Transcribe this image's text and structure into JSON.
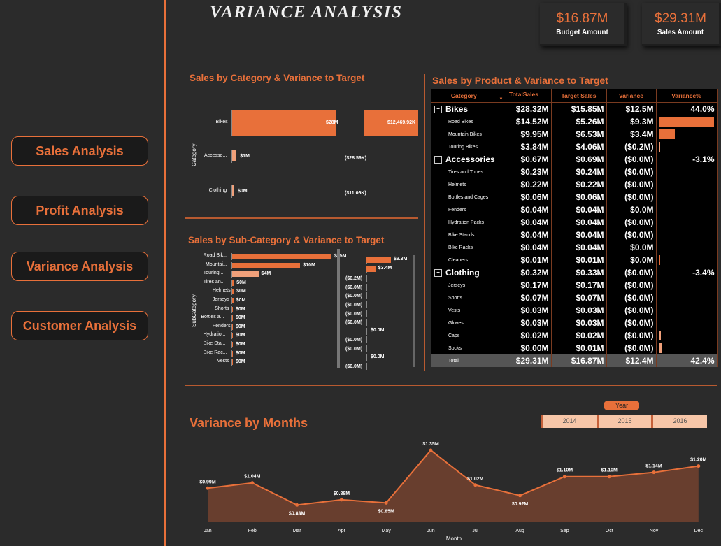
{
  "title": "VARIANCE  ANALYSIS",
  "kpis": [
    {
      "value": "$16.87M",
      "label": "Budget Amount"
    },
    {
      "value": "$29.31M",
      "label": "Sales Amount"
    }
  ],
  "nav": [
    "Sales Analysis",
    "Profit Analysis",
    "Variance Analysis",
    "Customer Analysis"
  ],
  "category_chart": {
    "title": "Sales by Category & Variance to Target",
    "axis_title": "Category",
    "rows": [
      {
        "label": "Bikes",
        "sales": "$28M",
        "sales_value": 28,
        "var": "$12,469.92K",
        "var_value": 12469.92
      },
      {
        "label": "Accesso...",
        "sales": "$1M",
        "sales_value": 1,
        "var": "($28.59K)",
        "var_value": -28.59
      },
      {
        "label": "Clothing",
        "sales": "$0M",
        "sales_value": 0.3,
        "var": "($11.06K)",
        "var_value": -11.06
      }
    ]
  },
  "subcategory_chart": {
    "title": "Sales by Sub-Category & Variance to Target",
    "axis_title": "SubCategory",
    "rows": [
      {
        "label": "Road Bik...",
        "sales": "$15M",
        "sales_value": 14.52,
        "var": "$9.3M",
        "var_value": 9.3
      },
      {
        "label": "Mountai...",
        "sales": "$10M",
        "sales_value": 9.95,
        "var": "$3.4M",
        "var_value": 3.4
      },
      {
        "label": "Touring ...",
        "sales": "$4M",
        "sales_value": 3.84,
        "var": "($0.2M)",
        "var_value": -0.2
      },
      {
        "label": "Tires an...",
        "sales": "$0M",
        "sales_value": 0.23,
        "var": "($0.0M)",
        "var_value": -0.01
      },
      {
        "label": "Helmets",
        "sales": "$0M",
        "sales_value": 0.22,
        "var": "($0.0M)",
        "var_value": -0.01
      },
      {
        "label": "Jerseys",
        "sales": "$0M",
        "sales_value": 0.17,
        "var": "($0.0M)",
        "var_value": -0.01
      },
      {
        "label": "Shorts",
        "sales": "$0M",
        "sales_value": 0.07,
        "var": "($0.0M)",
        "var_value": -0.01
      },
      {
        "label": "Bottles a...",
        "sales": "$0M",
        "sales_value": 0.06,
        "var": "($0.0M)",
        "var_value": -0.01
      },
      {
        "label": "Fenders",
        "sales": "$0M",
        "sales_value": 0.04,
        "var": "$0.0M",
        "var_value": 0.0
      },
      {
        "label": "Hydratio...",
        "sales": "$0M",
        "sales_value": 0.04,
        "var": "($0.0M)",
        "var_value": -0.01
      },
      {
        "label": "Bike Sta...",
        "sales": "$0M",
        "sales_value": 0.04,
        "var": "($0.0M)",
        "var_value": -0.01
      },
      {
        "label": "Bike Rac...",
        "sales": "$0M",
        "sales_value": 0.04,
        "var": "$0.0M",
        "var_value": 0.0
      },
      {
        "label": "Vests",
        "sales": "$0M",
        "sales_value": 0.03,
        "var": "($0.0M)",
        "var_value": -0.01
      }
    ]
  },
  "matrix": {
    "title": "Sales by Product & Variance to Target",
    "headers": [
      "Category",
      "TotalSales",
      "Target Sales",
      "Variance",
      "Variance%"
    ],
    "rows": [
      {
        "type": "group",
        "name": "Bikes",
        "sales": "$28.32M",
        "target": "$15.85M",
        "variance": "$12.5M",
        "pct": "44.0%"
      },
      {
        "type": "item",
        "name": "Road Bikes",
        "sales": "$14.52M",
        "target": "$5.26M",
        "variance": "$9.3M",
        "pct_value": 176
      },
      {
        "type": "item",
        "name": "Mountain Bikes",
        "sales": "$9.95M",
        "target": "$6.53M",
        "variance": "$3.4M",
        "pct_value": 52
      },
      {
        "type": "item",
        "name": "Touring Bikes",
        "sales": "$3.84M",
        "target": "$4.06M",
        "variance": "($0.2M)",
        "pct_value": -5
      },
      {
        "type": "group",
        "name": "Accessories",
        "sales": "$0.67M",
        "target": "$0.69M",
        "variance": "($0.0M)",
        "pct": "-3.1%"
      },
      {
        "type": "item",
        "name": "Tires and Tubes",
        "sales": "$0.23M",
        "target": "$0.24M",
        "variance": "($0.0M)",
        "pct_value": -4
      },
      {
        "type": "item",
        "name": "Helmets",
        "sales": "$0.22M",
        "target": "$0.22M",
        "variance": "($0.0M)",
        "pct_value": -3
      },
      {
        "type": "item",
        "name": "Bottles and Cages",
        "sales": "$0.06M",
        "target": "$0.06M",
        "variance": "($0.0M)",
        "pct_value": -4
      },
      {
        "type": "item",
        "name": "Fenders",
        "sales": "$0.04M",
        "target": "$0.04M",
        "variance": "$0.0M",
        "pct_value": 1
      },
      {
        "type": "item",
        "name": "Hydration Packs",
        "sales": "$0.04M",
        "target": "$0.04M",
        "variance": "($0.0M)",
        "pct_value": -3
      },
      {
        "type": "item",
        "name": "Bike Stands",
        "sales": "$0.04M",
        "target": "$0.04M",
        "variance": "($0.0M)",
        "pct_value": -2
      },
      {
        "type": "item",
        "name": "Bike Racks",
        "sales": "$0.04M",
        "target": "$0.04M",
        "variance": "$0.0M",
        "pct_value": 1
      },
      {
        "type": "item",
        "name": "Cleaners",
        "sales": "$0.01M",
        "target": "$0.01M",
        "variance": "$0.0M",
        "pct_value": 5
      },
      {
        "type": "group",
        "name": "Clothing",
        "sales": "$0.32M",
        "target": "$0.33M",
        "variance": "($0.0M)",
        "pct": "-3.4%"
      },
      {
        "type": "item",
        "name": "Jerseys",
        "sales": "$0.17M",
        "target": "$0.17M",
        "variance": "($0.0M)",
        "pct_value": -3
      },
      {
        "type": "item",
        "name": "Shorts",
        "sales": "$0.07M",
        "target": "$0.07M",
        "variance": "($0.0M)",
        "pct_value": -2
      },
      {
        "type": "item",
        "name": "Vests",
        "sales": "$0.03M",
        "target": "$0.03M",
        "variance": "($0.0M)",
        "pct_value": -3
      },
      {
        "type": "item",
        "name": "Gloves",
        "sales": "$0.03M",
        "target": "$0.03M",
        "variance": "($0.0M)",
        "pct_value": -3
      },
      {
        "type": "item",
        "name": "Caps",
        "sales": "$0.02M",
        "target": "$0.02M",
        "variance": "($0.0M)",
        "pct_value": -7
      },
      {
        "type": "item",
        "name": "Socks",
        "sales": "$0.00M",
        "target": "$0.01M",
        "variance": "($0.0M)",
        "pct_value": -9
      }
    ],
    "total": {
      "name": "Total",
      "sales": "$29.31M",
      "target": "$16.87M",
      "variance": "$12.4M",
      "pct": "42.4%"
    }
  },
  "year_slicer": {
    "label": "Year",
    "options": [
      "2014",
      "2015",
      "2016"
    ]
  },
  "chart_data": {
    "type": "area",
    "title": "Variance by Months",
    "xlabel": "Month",
    "ylabel": "",
    "categories": [
      "Jan",
      "Feb",
      "Mar",
      "Apr",
      "May",
      "Jun",
      "Jul",
      "Aug",
      "Sep",
      "Oct",
      "Nov",
      "Dec"
    ],
    "values": [
      0.99,
      1.04,
      0.83,
      0.88,
      0.85,
      1.35,
      1.02,
      0.92,
      1.1,
      1.1,
      1.14,
      1.2
    ],
    "labels": [
      "$0.99M",
      "$1.04M",
      "$0.83M",
      "$0.88M",
      "$0.85M",
      "$1.35M",
      "$1.02M",
      "$0.92M",
      "$1.10M",
      "$1.10M",
      "$1.14M",
      "$1.20M"
    ],
    "colors": {
      "line": "#e8703a",
      "fill": "#6b3f2e"
    }
  }
}
